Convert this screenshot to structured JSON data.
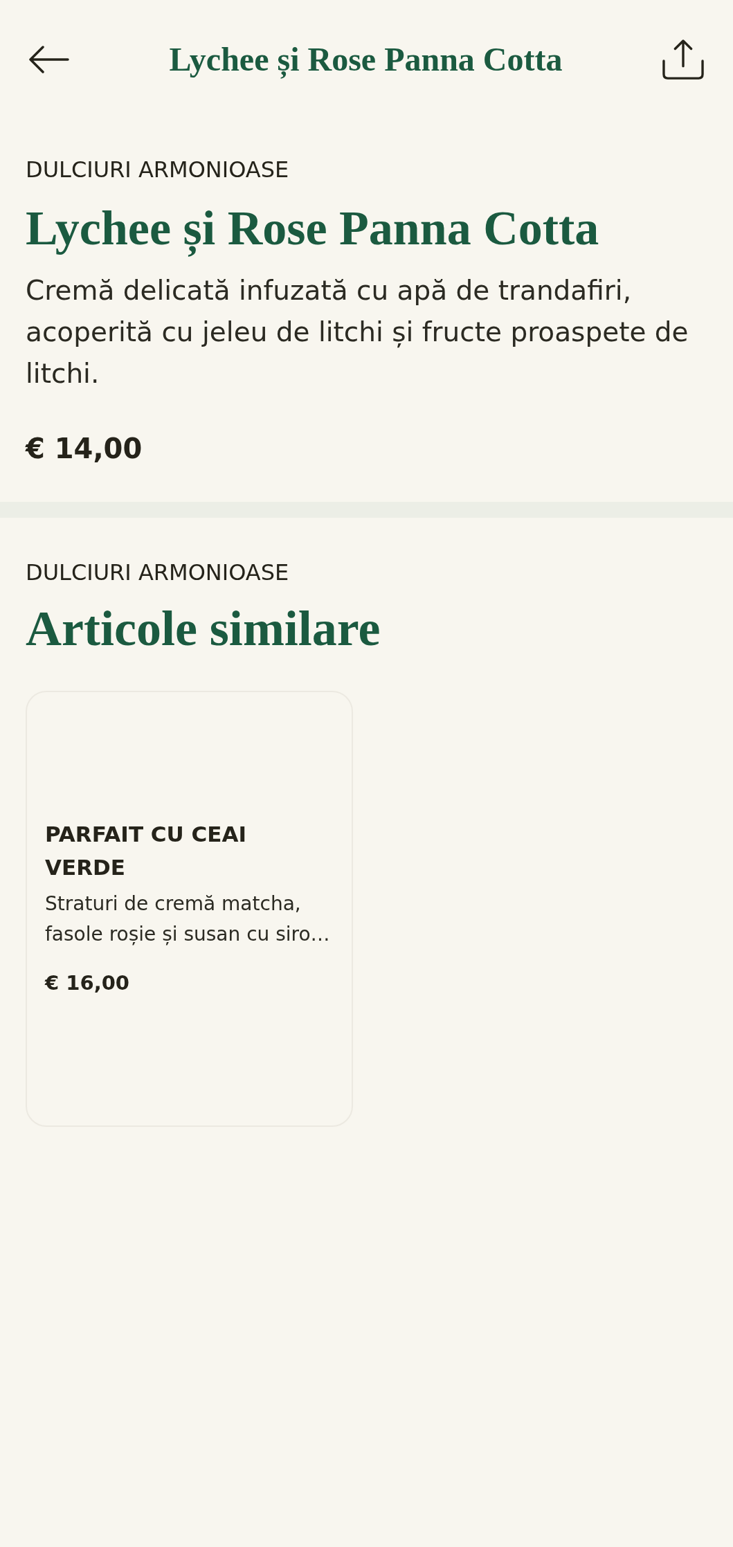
{
  "header": {
    "title": "Lychee și Rose Panna Cotta"
  },
  "product": {
    "category": "DULCIURI ARMONIOASE",
    "name": "Lychee și Rose Panna Cotta",
    "description": "Cremă delicată infuzată cu apă de trandafiri, acoperită cu jeleu de litchi și fructe proaspete de litchi.",
    "price": "€ 14,00"
  },
  "similar": {
    "category": "DULCIURI ARMONIOASE",
    "title": "Articole similare",
    "items": [
      {
        "name": "PARFAIT CU CEAI VERDE",
        "description": "Straturi de cremă matcha, fasole roșie și susan cu siro…",
        "price": "€ 16,00"
      }
    ]
  }
}
